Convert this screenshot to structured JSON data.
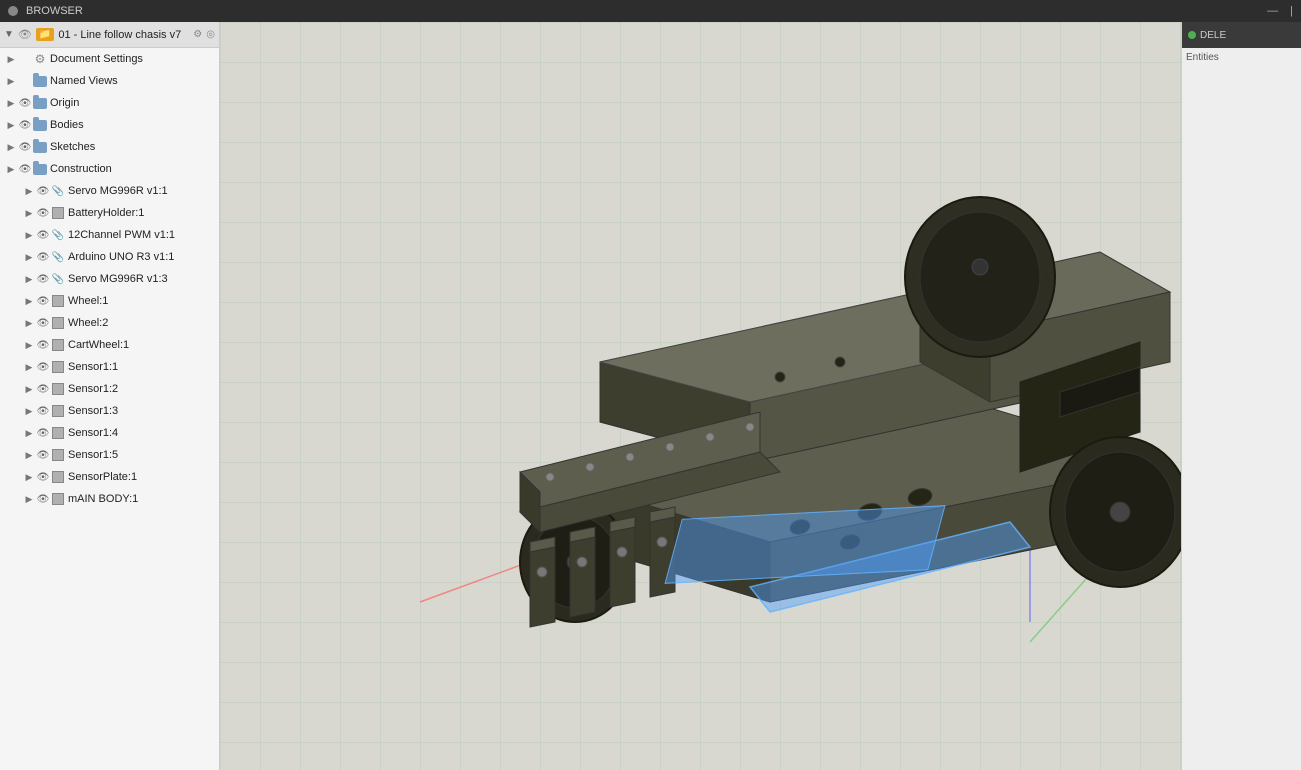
{
  "titlebar": {
    "label": "BROWSER",
    "close_symbol": "—",
    "pipe_symbol": "|"
  },
  "document_tab": {
    "label": "01 - Line follow chasis v7",
    "settings_symbol": "⚙",
    "lock_symbol": "◎"
  },
  "tree": {
    "items": [
      {
        "id": "doc-settings",
        "label": "Document Settings",
        "indent": 0,
        "icon": "gear",
        "toggled": false,
        "eye": false
      },
      {
        "id": "named-views",
        "label": "Named Views",
        "indent": 0,
        "icon": "folder",
        "toggled": false,
        "eye": false
      },
      {
        "id": "origin",
        "label": "Origin",
        "indent": 0,
        "icon": "folder",
        "toggled": false,
        "eye": true
      },
      {
        "id": "bodies",
        "label": "Bodies",
        "indent": 0,
        "icon": "folder",
        "toggled": false,
        "eye": true
      },
      {
        "id": "sketches",
        "label": "Sketches",
        "indent": 0,
        "icon": "folder",
        "toggled": false,
        "eye": true
      },
      {
        "id": "construction",
        "label": "Construction",
        "indent": 0,
        "icon": "folder",
        "toggled": false,
        "eye": true
      },
      {
        "id": "servo1",
        "label": "Servo MG996R v1:1",
        "indent": 1,
        "icon": "link",
        "toggled": false,
        "eye": true
      },
      {
        "id": "battery",
        "label": "BatteryHolder:1",
        "indent": 1,
        "icon": "body",
        "toggled": false,
        "eye": true
      },
      {
        "id": "pwm",
        "label": "12Channel PWM v1:1",
        "indent": 1,
        "icon": "link",
        "toggled": false,
        "eye": true
      },
      {
        "id": "arduino",
        "label": "Arduino UNO R3 v1:1",
        "indent": 1,
        "icon": "link",
        "toggled": false,
        "eye": true
      },
      {
        "id": "servo3",
        "label": "Servo MG996R v1:3",
        "indent": 1,
        "icon": "link",
        "toggled": false,
        "eye": true
      },
      {
        "id": "wheel1",
        "label": "Wheel:1",
        "indent": 1,
        "icon": "body",
        "toggled": false,
        "eye": true
      },
      {
        "id": "wheel2",
        "label": "Wheel:2",
        "indent": 1,
        "icon": "body",
        "toggled": false,
        "eye": true
      },
      {
        "id": "cartwheel",
        "label": "CartWheel:1",
        "indent": 1,
        "icon": "body",
        "toggled": false,
        "eye": true
      },
      {
        "id": "sensor1",
        "label": "Sensor1:1",
        "indent": 1,
        "icon": "body",
        "toggled": false,
        "eye": true
      },
      {
        "id": "sensor2",
        "label": "Sensor1:2",
        "indent": 1,
        "icon": "body",
        "toggled": false,
        "eye": true
      },
      {
        "id": "sensor3",
        "label": "Sensor1:3",
        "indent": 1,
        "icon": "body",
        "toggled": false,
        "eye": true
      },
      {
        "id": "sensor4",
        "label": "Sensor1:4",
        "indent": 1,
        "icon": "body",
        "toggled": false,
        "eye": true
      },
      {
        "id": "sensor5",
        "label": "Sensor1:5",
        "indent": 1,
        "icon": "body",
        "toggled": false,
        "eye": true
      },
      {
        "id": "sensorplate",
        "label": "SensorPlate:1",
        "indent": 1,
        "icon": "body",
        "toggled": false,
        "eye": true
      },
      {
        "id": "mainbody",
        "label": "mAIN BODY:1",
        "indent": 1,
        "icon": "body",
        "toggled": false,
        "eye": true
      }
    ]
  },
  "right_panel": {
    "header": "DELE",
    "label": "Entities"
  },
  "colors": {
    "sidebar_bg": "#f5f5f5",
    "header_bg": "#3a3a3a",
    "viewport_bg": "#d8d8d0",
    "robot_body": "#5a5a4a",
    "selection_blue": "rgba(80,160,255,0.45)"
  }
}
